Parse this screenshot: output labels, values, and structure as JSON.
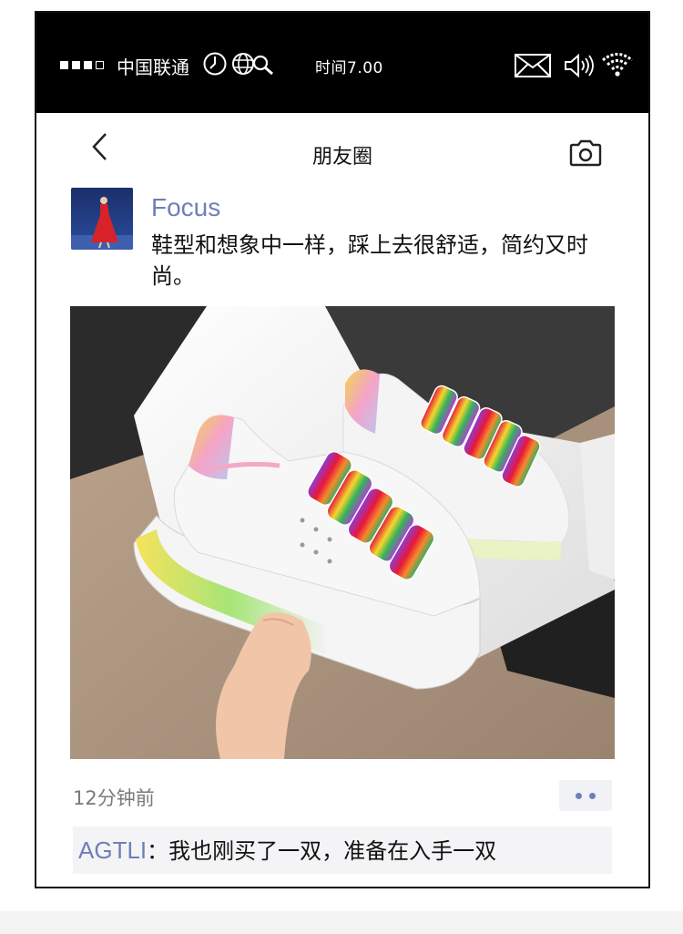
{
  "status_bar": {
    "carrier": "中国联通",
    "time": "时间7.00",
    "icons": [
      "signal-dots-icon",
      "clock-icon",
      "globe-icon",
      "search-icon",
      "mail-icon",
      "volume-icon",
      "wifi-icon"
    ]
  },
  "nav": {
    "title": "朋友圈",
    "back_icon": "chevron-left-icon",
    "camera_icon": "camera-icon"
  },
  "post": {
    "username": "Focus",
    "text": "鞋型和想象中一样，踩上去很舒适，简约又时尚。",
    "time_ago": "12分钟前",
    "image_subject": "white sneakers with rainbow laces and translucent rainbow air sole"
  },
  "comment": {
    "author": "AGTLI",
    "separator": "：",
    "text": "我也刚买了一双，准备在入手一双"
  },
  "colors": {
    "link": "#6e7fb8",
    "status_bar_bg": "#000000",
    "comment_bg": "#f4f4f6"
  }
}
